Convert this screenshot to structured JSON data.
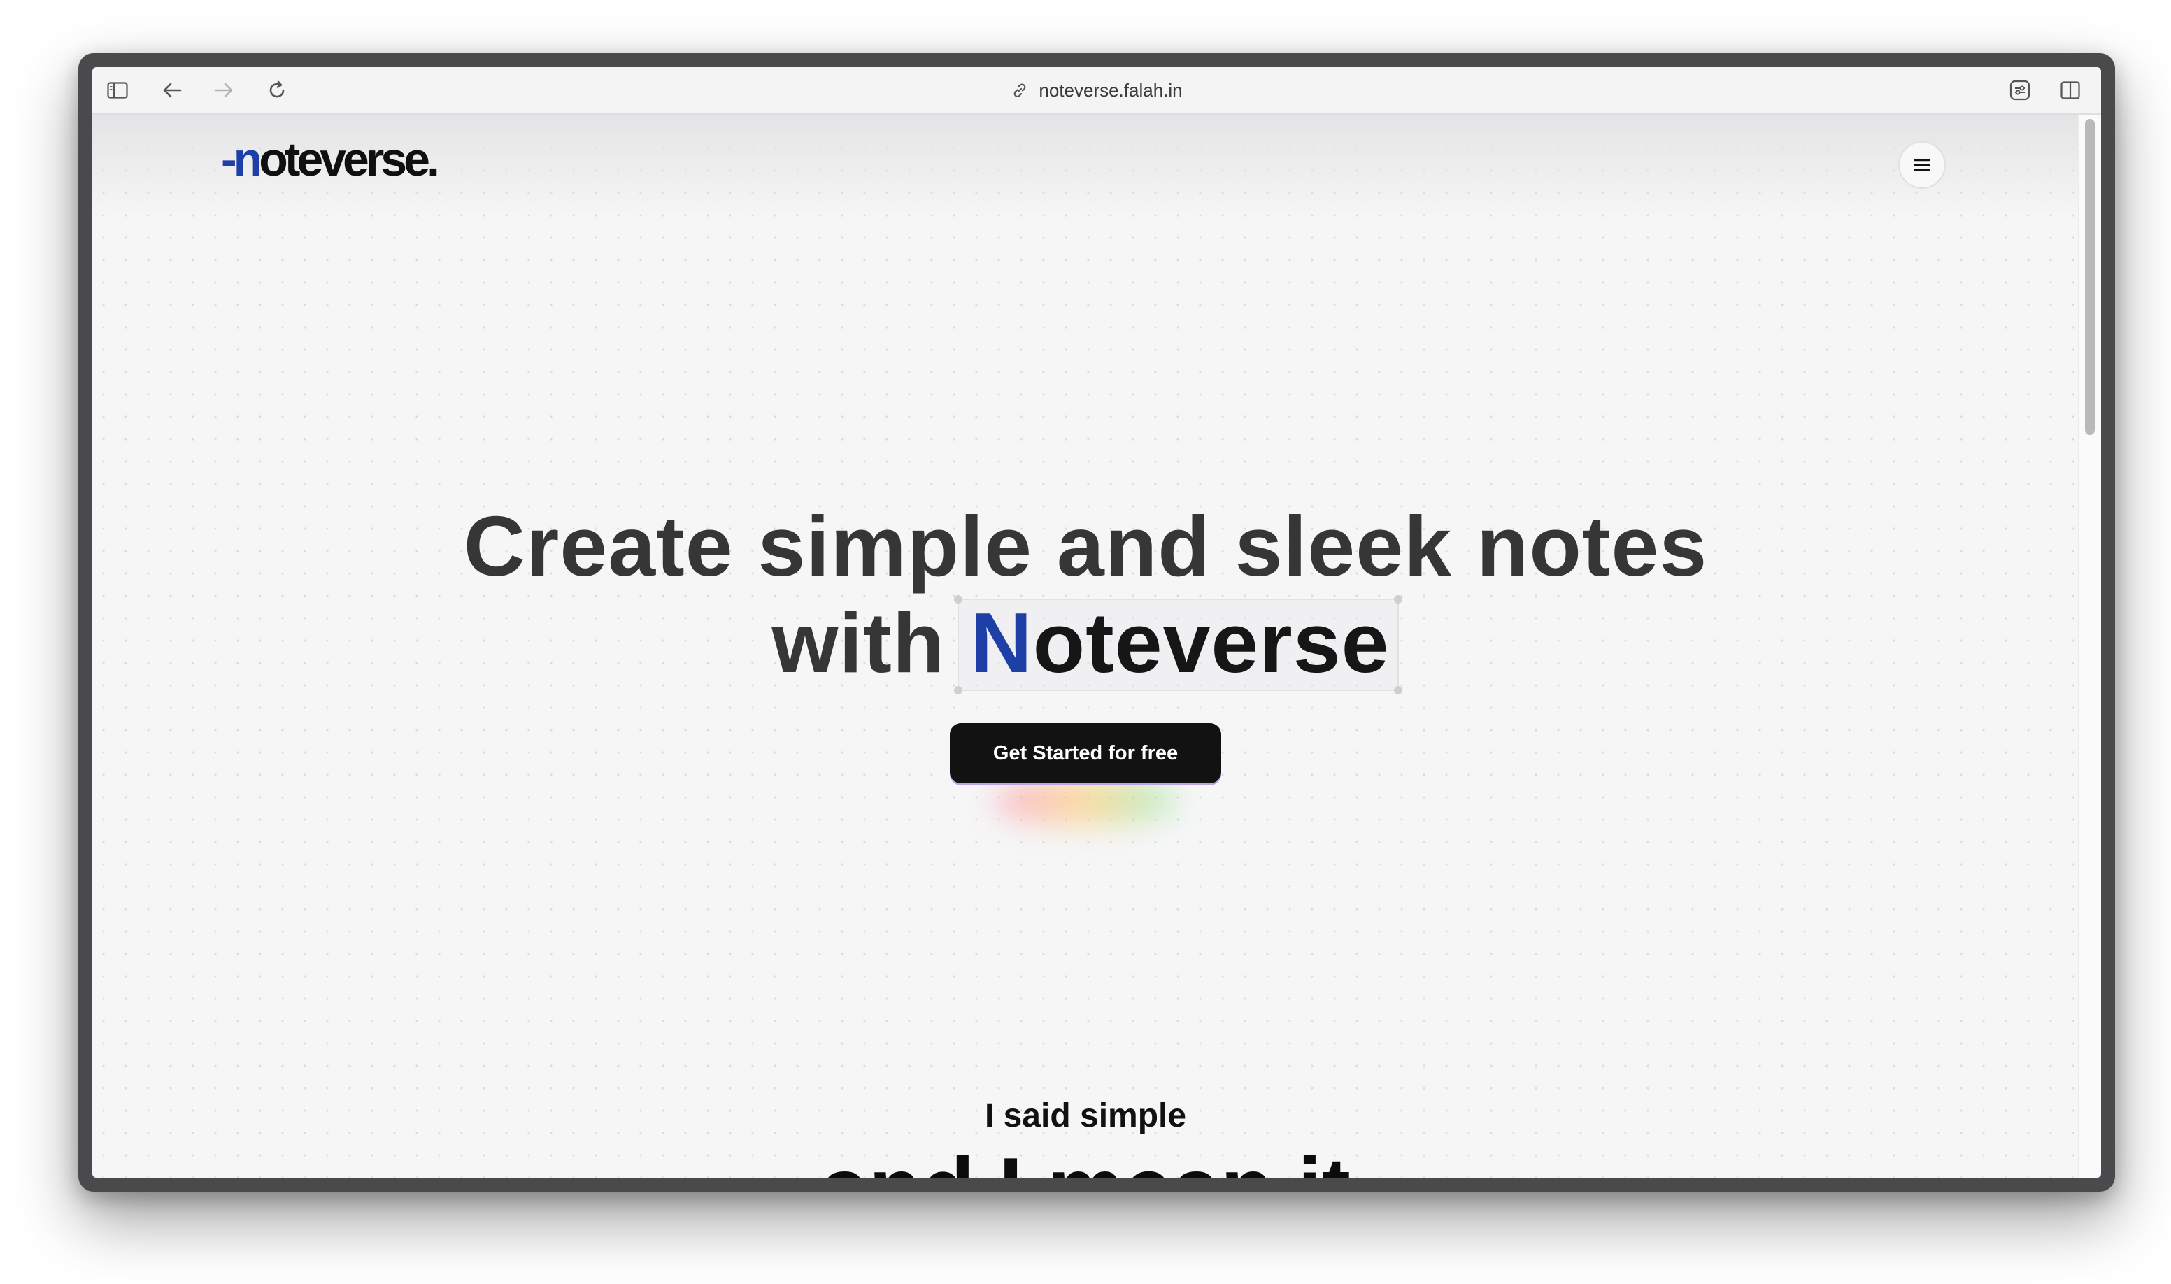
{
  "browser": {
    "url": "noteverse.falah.in",
    "icons": {
      "sidebar": "sidebar-toggle-icon",
      "back": "arrow-left-icon",
      "forward": "arrow-right-icon",
      "reload": "reload-icon",
      "link": "link-icon",
      "extension": "sliders-icon",
      "split": "split-view-icon"
    }
  },
  "site": {
    "logo_dash": "-",
    "logo_n": "n",
    "logo_rest": "oteverse.",
    "menu_icon": "hamburger-menu-icon"
  },
  "hero": {
    "line1": "Create simple and sleek notes",
    "line2_prefix": "with",
    "brand_first": "N",
    "brand_rest": "oteverse",
    "cta_label": "Get Started for free"
  },
  "section": {
    "eyebrow": "I said simple",
    "headline": "and I mean it"
  },
  "colors": {
    "brand_blue": "#1e3fa6",
    "cta_background": "#121212",
    "heading_text": "#363636"
  }
}
